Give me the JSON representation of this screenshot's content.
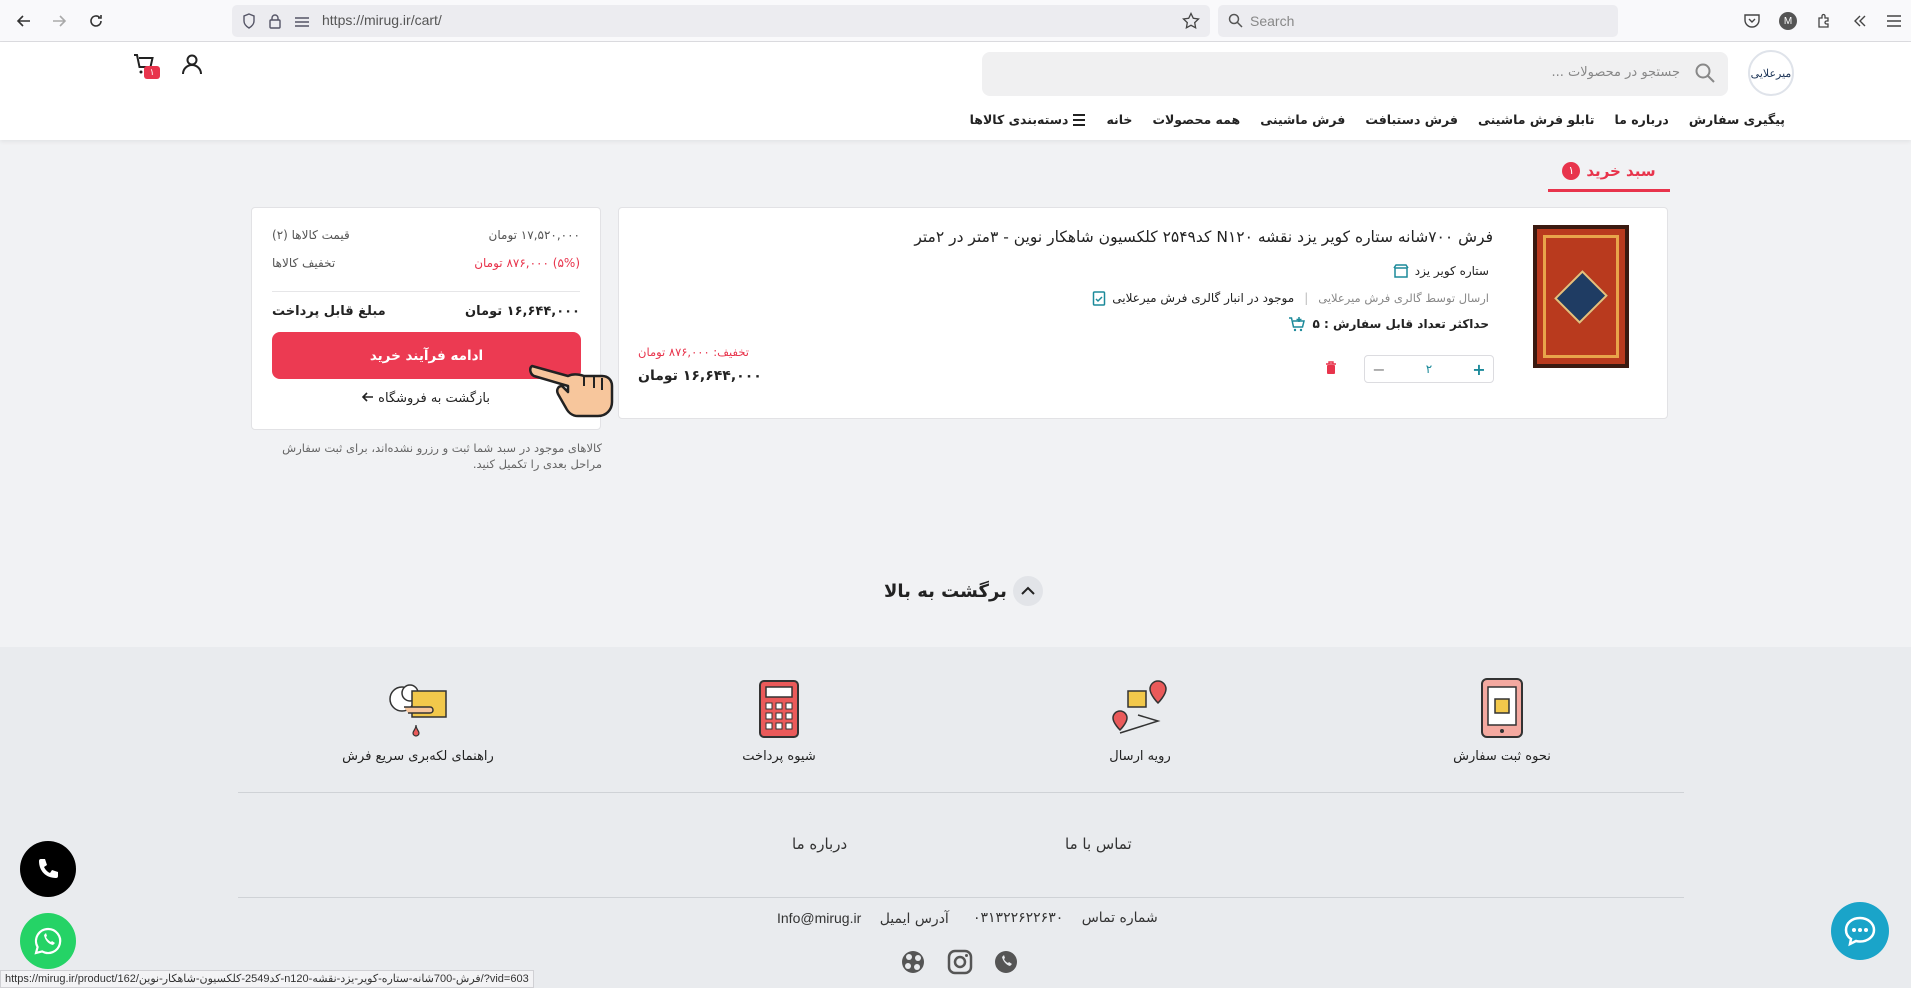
{
  "browser": {
    "url": "https://mirug.ir/cart/",
    "search_placeholder": "Search",
    "profile_initial": "M"
  },
  "header": {
    "search_placeholder": "جستجو در محصولات ...",
    "cart_count": "۱",
    "logo_text": "میرعلایی"
  },
  "nav": {
    "items": [
      {
        "label": "دسته‌بندی کالاها"
      },
      {
        "label": "خانه"
      },
      {
        "label": "همه محصولات"
      },
      {
        "label": "فرش ماشینی"
      },
      {
        "label": "فرش دستبافت"
      },
      {
        "label": "تابلو فرش ماشینی"
      },
      {
        "label": "درباره ما"
      },
      {
        "label": "پیگیری سفارش"
      }
    ]
  },
  "cart_tab": {
    "label": "سبد خرید",
    "count": "۱"
  },
  "product": {
    "title": "فرش ۷۰۰شانه ستاره کویر یزد نقشه N۱۲۰ کد۲۵۴۹ کلکسیون شاهکار نوین - ۳متر در ۲متر",
    "brand": "ستاره کویر یزد",
    "stock": "موجود در انبار گالری فرش میرعلایی",
    "shipping": "ارسال توسط گالری فرش میرعلایی",
    "max_order": "حداکثر تعداد قابل سفارش : ۵",
    "quantity": "۲",
    "discount": "تخفیف: ۸۷۶,۰۰۰ تومان",
    "price": "۱۶,۶۴۴,۰۰۰ تومان"
  },
  "summary": {
    "items_price_label": "قیمت کالاها (۲)",
    "items_price_value": "۱۷,۵۲۰,۰۰۰ تومان",
    "discount_label": "تخفیف کالاها",
    "discount_value": "(۵%) ۸۷۶,۰۰۰ تومان",
    "payable_label": "مبلغ قابل پرداخت",
    "payable_value": "۱۶,۶۴۴,۰۰۰ تومان",
    "checkout_label": "ادامه فرآیند خرید",
    "back_label": "بازگشت به فروشگاه",
    "note": "کالاهای موجود در سبد شما ثبت و رزرو نشده‌اند، برای ثبت سفارش مراحل بعدی را تکمیل کنید."
  },
  "back_to_top": "برگشت به بالا",
  "footer": {
    "features": [
      {
        "label": "نحوه ثبت سفارش"
      },
      {
        "label": "رویه ارسال"
      },
      {
        "label": "شیوه پرداخت"
      },
      {
        "label": "راهنمای لکه‌بری سریع فرش"
      }
    ],
    "links": {
      "contact": "تماس با ما",
      "about": "درباره ما"
    },
    "phone_label": "شماره تماس",
    "phone_value": "۰۳۱۳۲۲۶۲۲۶۳۰",
    "email_label": "آدرس ایمیل",
    "email_value": "Info@mirug.ir"
  },
  "status_url": "https://mirug.ir/product/162/کد2549-کلکسیون-شاهکار-نوین-n120-فرش-700شانه-ستاره-کویر-یزد-نقشه/?vid=603",
  "colors": {
    "accent": "#e8344c",
    "teal": "#1c8a9a",
    "footer_bg": "#e9ebee"
  }
}
